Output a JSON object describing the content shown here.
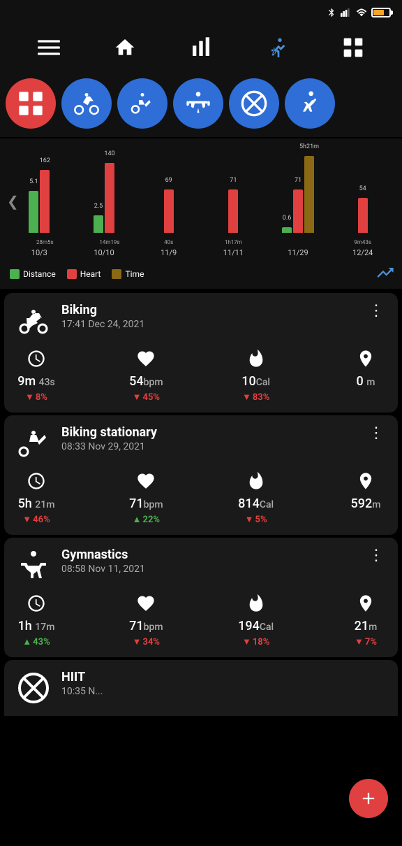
{
  "statusBar": {
    "bluetooth": "bluetooth",
    "signal": "signal",
    "wifi": "wifi",
    "battery": "79"
  },
  "topNav": {
    "items": [
      {
        "name": "menu",
        "label": "Menu",
        "icon": "hamburger"
      },
      {
        "name": "home",
        "label": "Home",
        "icon": "home"
      },
      {
        "name": "chart",
        "label": "Chart",
        "icon": "bar-chart"
      },
      {
        "name": "activity",
        "label": "Activity",
        "icon": "running",
        "active": true
      },
      {
        "name": "apps",
        "label": "Apps",
        "icon": "grid"
      }
    ]
  },
  "filterBar": {
    "items": [
      {
        "name": "all",
        "label": "All",
        "icon": "grid-dots",
        "active": true
      },
      {
        "name": "biking",
        "label": "Biking",
        "icon": "cycling",
        "active": false
      },
      {
        "name": "biking-stationary",
        "label": "Biking Stationary",
        "icon": "stationary-bike",
        "active": false
      },
      {
        "name": "gymnastics",
        "label": "Gymnastics",
        "icon": "weightlifting",
        "active": false
      },
      {
        "name": "hiit",
        "label": "HIIT",
        "icon": "hiit",
        "active": false
      },
      {
        "name": "running",
        "label": "Running",
        "icon": "running-person",
        "active": false
      }
    ]
  },
  "chart": {
    "groups": [
      {
        "date": "10/3",
        "bars": [
          {
            "type": "green",
            "height": 60,
            "label": "5.1"
          },
          {
            "type": "red",
            "height": 90,
            "label": "162"
          }
        ],
        "timeLabel": "28m5s"
      },
      {
        "date": "10/10",
        "bars": [
          {
            "type": "green",
            "height": 25,
            "label": "2.5"
          },
          {
            "type": "red",
            "height": 100,
            "label": "140"
          }
        ],
        "timeLabel": "14m19s"
      },
      {
        "date": "11/9",
        "bars": [
          {
            "type": "red",
            "height": 60,
            "label": "69"
          }
        ],
        "timeLabel": "40s"
      },
      {
        "date": "11/11",
        "bars": [
          {
            "type": "red",
            "height": 62,
            "label": "71"
          }
        ],
        "timeLabel": "1h17m"
      },
      {
        "date": "11/29",
        "bars": [
          {
            "type": "green",
            "height": 8,
            "label": "0.6"
          },
          {
            "type": "red",
            "height": 62,
            "label": "71"
          },
          {
            "type": "brown",
            "height": 110,
            "label": "5h21m"
          }
        ],
        "timeLabel": ""
      },
      {
        "date": "12/24",
        "bars": [
          {
            "type": "red",
            "height": 50,
            "label": "54"
          }
        ],
        "timeLabel": "9m43s"
      }
    ],
    "legend": [
      {
        "color": "#4caf50",
        "label": "Distance"
      },
      {
        "color": "#e04040",
        "label": "Heart"
      },
      {
        "color": "#8b6914",
        "label": "Time"
      }
    ]
  },
  "activities": [
    {
      "id": "biking-1224",
      "type": "Biking",
      "datetime": "17:41 Dec 24, 2021",
      "stats": {
        "duration": {
          "value": "9m",
          "sub": "43s",
          "change": "-8%",
          "direction": "down"
        },
        "heart": {
          "value": "54",
          "unit": "bpm",
          "change": "-45%",
          "direction": "down"
        },
        "calories": {
          "value": "10",
          "unit": "Cal",
          "change": "-83%",
          "direction": "down"
        },
        "distance": {
          "value": "0",
          "unit": "m",
          "change": "",
          "direction": "none"
        }
      }
    },
    {
      "id": "biking-stationary-1129",
      "type": "Biking stationary",
      "datetime": "08:33 Nov 29, 2021",
      "stats": {
        "duration": {
          "value": "5h",
          "sub": "21m",
          "change": "-46%",
          "direction": "down"
        },
        "heart": {
          "value": "71",
          "unit": "bpm",
          "change": "+22%",
          "direction": "up"
        },
        "calories": {
          "value": "814",
          "unit": "Cal",
          "change": "-5%",
          "direction": "down"
        },
        "distance": {
          "value": "592",
          "unit": "m",
          "change": "",
          "direction": "none"
        }
      }
    },
    {
      "id": "gymnastics-1111",
      "type": "Gymnastics",
      "datetime": "08:58 Nov 11, 2021",
      "stats": {
        "duration": {
          "value": "1h",
          "sub": "17m",
          "change": "+43%",
          "direction": "up"
        },
        "heart": {
          "value": "71",
          "unit": "bpm",
          "change": "-34%",
          "direction": "down"
        },
        "calories": {
          "value": "194",
          "unit": "Cal",
          "change": "-18%",
          "direction": "down"
        },
        "distance": {
          "value": "21",
          "unit": "m",
          "change": "-7%",
          "direction": "down"
        }
      }
    },
    {
      "id": "hiit-partial",
      "type": "HIIT",
      "datetime": "10:35 N...",
      "stats": {}
    }
  ],
  "fab": {
    "label": "+"
  }
}
